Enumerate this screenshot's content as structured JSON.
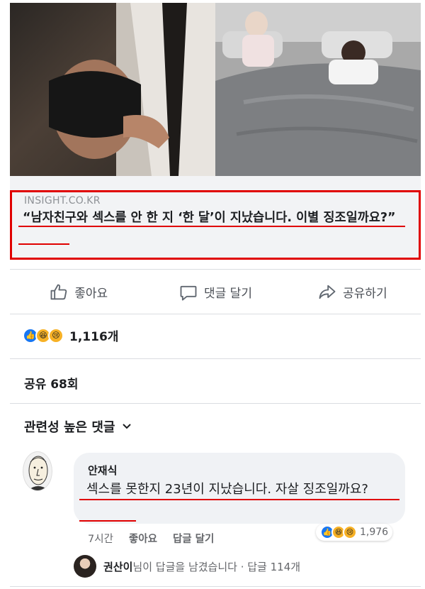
{
  "link_preview": {
    "source": "INSIGHT.CO.KR",
    "headline": "“남자친구와 섹스를 안 한 지 ‘한 달’이 지났습니다. 이별 징조일까요?”"
  },
  "actions": [
    {
      "label": "좋아요",
      "icon": "thumbs-up-icon"
    },
    {
      "label": "댓글 달기",
      "icon": "comment-icon"
    },
    {
      "label": "공유하기",
      "icon": "share-icon"
    }
  ],
  "post_reactions": {
    "icons": [
      "like",
      "haha",
      "sad"
    ],
    "count": "1,116개"
  },
  "shares": "공유 68회",
  "comment_sort": "관련성 높은 댓글",
  "comment": {
    "author": "안재식",
    "text": "섹스를 못한지 23년이 지났습니다. 자살 징조일까요?",
    "time": "7시간",
    "like": "좋아요",
    "reply": "답글 달기",
    "reaction_count": "1,976"
  },
  "reply_summary": {
    "name": "권산이",
    "text": "님이 답글을 남겼습니다 · 답글 114개"
  },
  "colors": {
    "highlight": "#e00000",
    "facebook_blue": "#1877f2",
    "muted_text": "#65676b"
  }
}
